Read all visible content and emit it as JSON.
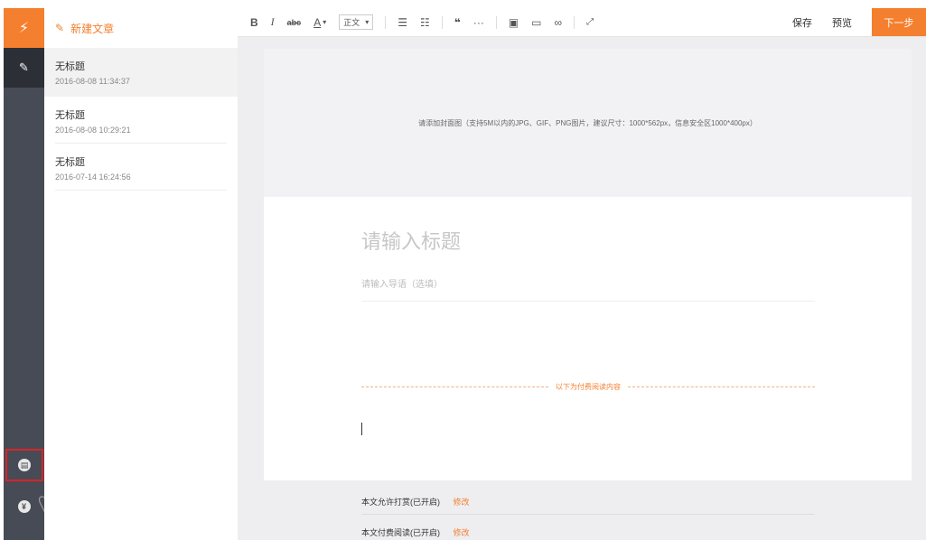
{
  "rail": {
    "top_icon": "⚡",
    "write_icon": "✎",
    "btn1_glyph": "▤",
    "btn2_glyph": "¥"
  },
  "list": {
    "new_label": "新建文章",
    "items": [
      {
        "title": "无标题",
        "date": "2016-08-08 11:34:37"
      },
      {
        "title": "无标题",
        "date": "2016-08-08 10:29:21"
      },
      {
        "title": "无标题",
        "date": "2016-07-14 16:24:56"
      }
    ]
  },
  "toolbar": {
    "bold": "B",
    "italic": "I",
    "strike": "abc",
    "font_color": "A",
    "paragraph": "正文",
    "quote": "❝",
    "hr": "···",
    "save": "保存",
    "preview": "预览",
    "next": "下一步"
  },
  "editor": {
    "cover_hint": "请添加封面图（支持5M以内的JPG、GIF、PNG图片，建议尺寸：1000*562px，信息安全区1000*400px）",
    "title_placeholder": "请输入标题",
    "lead_placeholder": "请输入导语（选填）",
    "paid_divider": "以下为付费阅读内容"
  },
  "footer": {
    "reward_label": "本文允许打赏(已开启)",
    "reward_edit": "修改",
    "paid_label": "本文付费阅读(已开启)",
    "paid_edit": "修改"
  },
  "colors": {
    "accent": "#f47f2e",
    "rail": "#474b55",
    "highlight": "#d8242a"
  }
}
